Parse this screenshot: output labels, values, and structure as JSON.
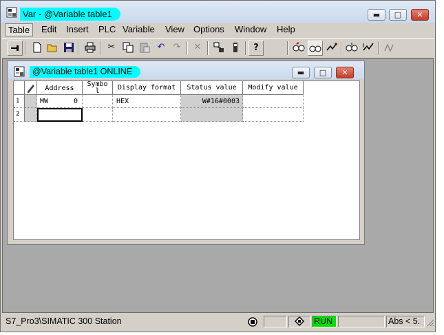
{
  "app": {
    "title": "Var - @Variable table1",
    "window_controls": {
      "minimize": "▬",
      "maximize": "□",
      "close": "✕"
    }
  },
  "menu": {
    "items": [
      "Table",
      "Edit",
      "Insert",
      "PLC",
      "Variable",
      "View",
      "Options",
      "Window",
      "Help"
    ]
  },
  "toolbar": {
    "icons": [
      "pin-icon",
      "new-document-icon",
      "open-folder-icon",
      "save-icon",
      "print-icon",
      "cut-icon",
      "copy-icon",
      "paste-icon",
      "undo-icon",
      "redo-icon",
      "delete-icon",
      "plc-connect-icon",
      "accessible-node-icon",
      "help-context-icon",
      "monitor-glasses-icon",
      "monitor-variable-icon",
      "modify-variable-icon",
      "update-monitor-icon",
      "activate-modify-icon",
      "force-icon"
    ],
    "glyphs": {
      "help": "?",
      "cut": "✂",
      "undo": "↶",
      "redo": "↷",
      "delete": "✕"
    }
  },
  "child_window": {
    "title": "@Variable table1  ONLINE",
    "window_controls": {
      "minimize": "▬",
      "maximize": "□",
      "close": "✕"
    }
  },
  "table": {
    "headers": {
      "address": "Address",
      "symbol": "Symbo\nl",
      "display_format": "Display format",
      "status_value": "Status value",
      "modify_value": "Modify value"
    },
    "rows": [
      {
        "num": "1",
        "address": "MW",
        "address_num": "0",
        "symbol": "",
        "display_format": "HEX",
        "status_value": "W#16#0003",
        "modify_value": ""
      },
      {
        "num": "2",
        "address": "",
        "address_num": "",
        "symbol": "",
        "display_format": "",
        "status_value": "",
        "modify_value": ""
      }
    ]
  },
  "statusbar": {
    "project": "S7_Pro3\\SIMATIC 300 Station",
    "mode": "RUN",
    "addressing": "Abs < 5.",
    "run_color": "#00e000"
  }
}
